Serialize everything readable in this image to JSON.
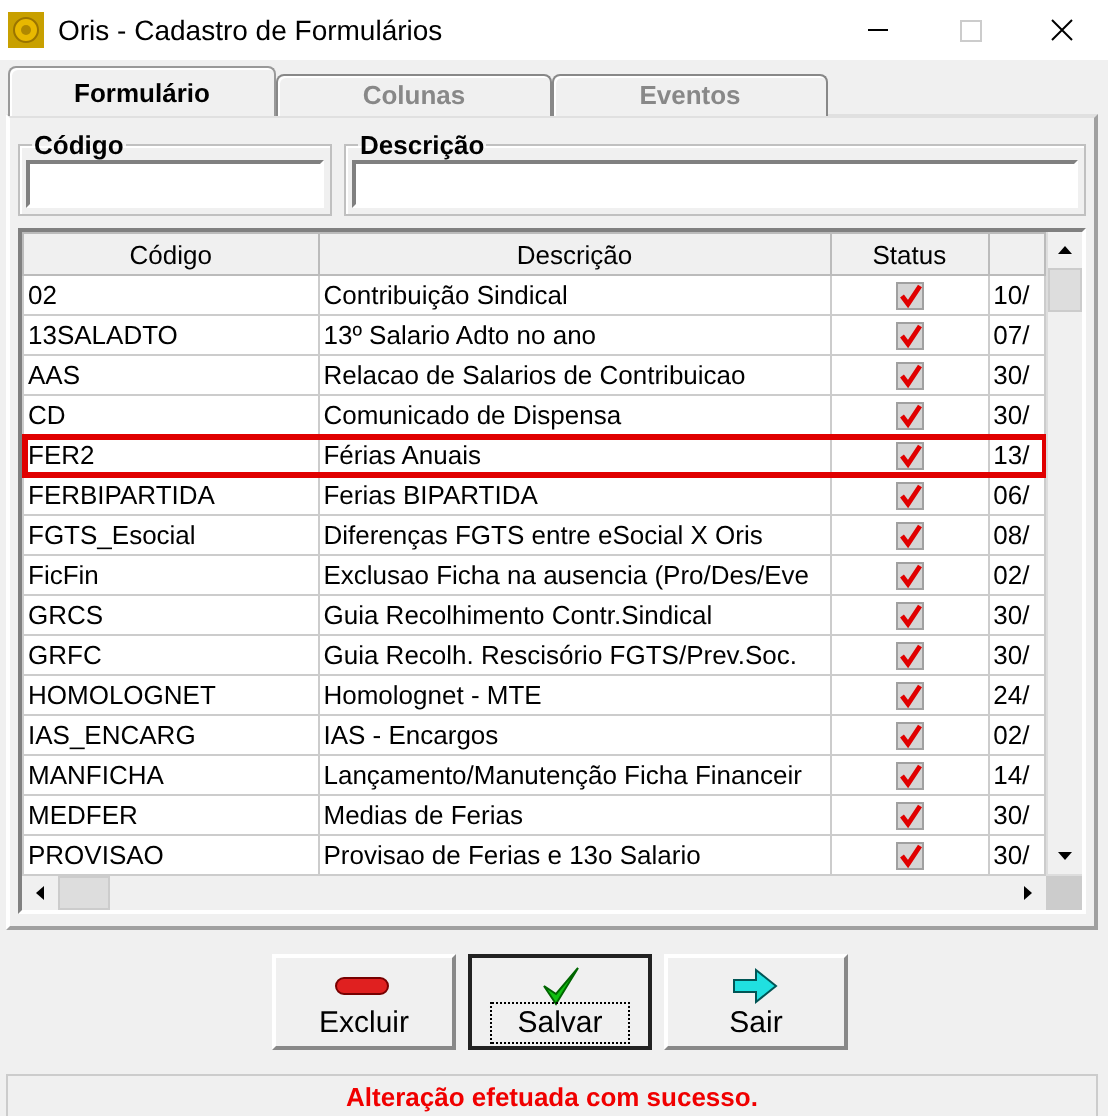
{
  "window": {
    "title": "Oris - Cadastro de Formulários"
  },
  "tabs": [
    {
      "label": "Formulário",
      "selected": true
    },
    {
      "label": "Colunas",
      "selected": false
    },
    {
      "label": "Eventos",
      "selected": false
    }
  ],
  "filters": [
    {
      "label": "Código"
    },
    {
      "label": "Descrição"
    }
  ],
  "table": {
    "columns": [
      "Código",
      "Descrição",
      "Status"
    ],
    "rows": [
      {
        "code": "02",
        "description": "Contribuição Sindical",
        "status": true,
        "column_4": "10/",
        "highlighted": false
      },
      {
        "code": "13SALADTO",
        "description": "13º Salario Adto no ano",
        "status": true,
        "column_4": "07/",
        "highlighted": false
      },
      {
        "code": "AAS",
        "description": "Relacao de Salarios de Contribuicao",
        "status": true,
        "column_4": "30/",
        "highlighted": false
      },
      {
        "code": "CD",
        "description": "Comunicado de Dispensa",
        "status": true,
        "column_4": "30/",
        "highlighted": false
      },
      {
        "code": "FER2",
        "description": "Férias Anuais",
        "status": true,
        "column_4": "13/",
        "highlighted": true
      },
      {
        "code": "FERBIPARTIDA",
        "description": "Ferias BIPARTIDA",
        "status": true,
        "column_4": "06/",
        "highlighted": false
      },
      {
        "code": "FGTS_Esocial",
        "description": "Diferenças FGTS entre eSocial X Oris",
        "status": true,
        "column_4": "08/",
        "highlighted": false
      },
      {
        "code": "FicFin",
        "description": "Exclusao Ficha na ausencia (Pro/Des/Eve",
        "status": true,
        "column_4": "02/",
        "highlighted": false
      },
      {
        "code": "GRCS",
        "description": "Guia Recolhimento Contr.Sindical",
        "status": true,
        "column_4": "30/",
        "highlighted": false
      },
      {
        "code": "GRFC",
        "description": "Guia Recolh. Rescisório FGTS/Prev.Soc.",
        "status": true,
        "column_4": "30/",
        "highlighted": false
      },
      {
        "code": "HOMOLOGNET",
        "description": "Homolognet - MTE",
        "status": true,
        "column_4": "24/",
        "highlighted": false
      },
      {
        "code": "IAS_ENCARG",
        "description": "IAS - Encargos",
        "status": true,
        "column_4": "02/",
        "highlighted": false
      },
      {
        "code": "MANFICHA",
        "description": "Lançamento/Manutenção Ficha Financeir",
        "status": true,
        "column_4": "14/",
        "highlighted": false
      },
      {
        "code": "MEDFER",
        "description": "Medias de Ferias",
        "status": true,
        "column_4": "30/",
        "highlighted": false
      },
      {
        "code": "PROVISAO",
        "description": "Provisao de Ferias e 13o Salario",
        "status": true,
        "column_4": "30/",
        "highlighted": false
      }
    ]
  },
  "buttons": [
    {
      "label": "Excluir",
      "kind": "delete",
      "focused": false
    },
    {
      "label": "Salvar",
      "kind": "save",
      "focused": true
    },
    {
      "label": "Sair",
      "kind": "exit",
      "focused": false
    }
  ],
  "status_bar": {
    "message": "Alteração efetuada com sucesso."
  }
}
